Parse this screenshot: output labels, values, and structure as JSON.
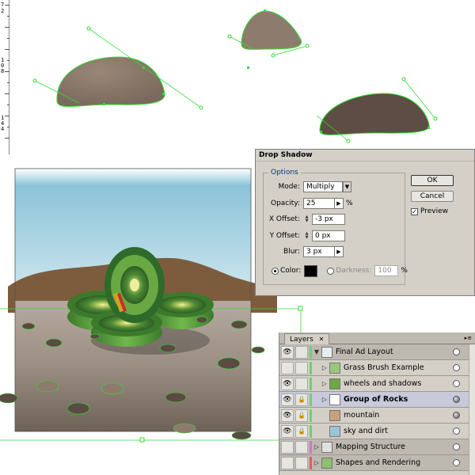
{
  "ruler": {
    "labels": [
      "7",
      "2",
      "1",
      "0",
      "8",
      "1",
      "4",
      "4"
    ]
  },
  "dialog": {
    "title": "Drop Shadow",
    "options_label": "Options",
    "mode_label": "Mode:",
    "mode_value": "Multiply",
    "opacity_label": "Opacity:",
    "opacity_value": "25",
    "opacity_unit": "%",
    "xoffset_label": "X Offset:",
    "xoffset_value": "-3 px",
    "yoffset_label": "Y Offset:",
    "yoffset_value": "0 px",
    "blur_label": "Blur:",
    "blur_value": "3 px",
    "color_label": "Color:",
    "shadow_color": "#000000",
    "darkness_label": "Darkness:",
    "darkness_value": "100",
    "darkness_unit": "%",
    "ok_label": "OK",
    "cancel_label": "Cancel",
    "preview_label": "Preview",
    "preview_checked": true
  },
  "layers_panel": {
    "tab_label": "Layers",
    "close_glyph": "✕",
    "rows": [
      {
        "name": "Final Ad Layout",
        "visible": true,
        "expanded": true,
        "color": "#6fd06f",
        "target_filled": false
      },
      {
        "name": "Grass Brush Example",
        "visible": false,
        "expanded": false,
        "color": "#6fd06f",
        "target_filled": false
      },
      {
        "name": "wheels and shadows",
        "visible": true,
        "expanded": false,
        "color": "#6fd06f",
        "target_filled": false
      },
      {
        "name": "Group of Rocks",
        "visible": true,
        "expanded": false,
        "color": "#6fd06f",
        "target_filled": true,
        "selected": true,
        "locked": true
      },
      {
        "name": "mountain",
        "visible": true,
        "expanded": false,
        "color": "#6fd06f",
        "target_filled": true,
        "locked": true
      },
      {
        "name": "sky and dirt",
        "visible": true,
        "expanded": false,
        "color": "#6fd06f",
        "target_filled": false,
        "locked": true
      },
      {
        "name": "Mapping Structure",
        "visible": false,
        "expanded": false,
        "color": "#d86fd8",
        "target_filled": false
      },
      {
        "name": "Shapes and Rendering",
        "visible": false,
        "expanded": false,
        "color": "#e85a5a",
        "target_filled": false
      }
    ]
  },
  "colors": {
    "selection_green": "#33dd33",
    "rock_tan": "#8c7a6b",
    "rock_dark": "#5a4a42",
    "sky_top": "#7fb6cf",
    "dirt": "#8c7a6a",
    "mountain": "#7a5a3a",
    "wheel_green": "#5a9a3a"
  }
}
